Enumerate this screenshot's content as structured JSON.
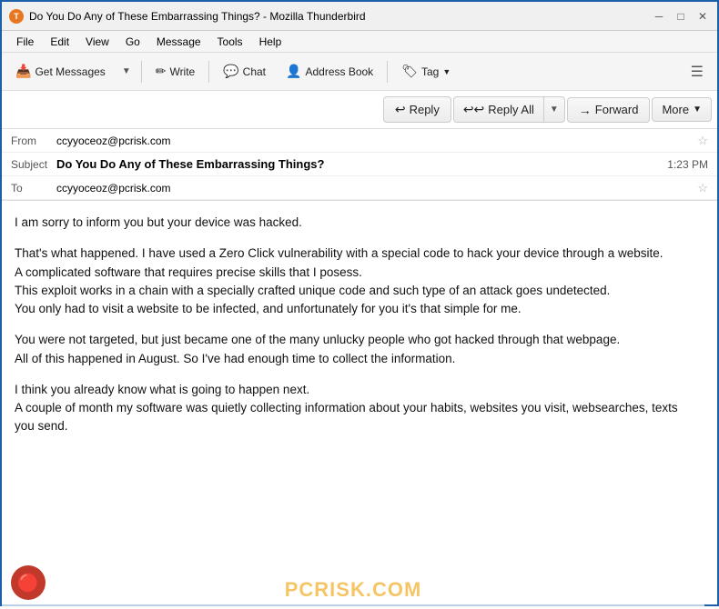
{
  "titlebar": {
    "icon": "🦅",
    "title": "Do You Do Any of These Embarrassing Things? - Mozilla Thunderbird",
    "minimize": "─",
    "restore": "□",
    "close": "✕"
  },
  "menubar": {
    "items": [
      "File",
      "Edit",
      "View",
      "Go",
      "Message",
      "Tools",
      "Help"
    ]
  },
  "toolbar": {
    "get_messages": "Get Messages",
    "get_messages_icon": "📥",
    "write": "Write",
    "write_icon": "✏",
    "chat": "Chat",
    "chat_icon": "💬",
    "address_book": "Address Book",
    "address_book_icon": "👤",
    "tag": "Tag",
    "tag_icon": "🏷",
    "hamburger": "☰"
  },
  "actions": {
    "reply": "Reply",
    "reply_icon": "↩",
    "reply_all": "Reply All",
    "reply_all_icon": "↩↩",
    "forward": "Forward",
    "forward_icon": "→",
    "more": "More",
    "more_arrow": "▼"
  },
  "email": {
    "from_label": "From",
    "from_value": "ccyyoceoz@pcrisk.com",
    "subject_label": "Subject",
    "subject_value": "Do You Do Any of These Embarrassing Things?",
    "time": "1:23 PM",
    "to_label": "To",
    "to_value": "ccyyoceoz@pcrisk.com",
    "body_paragraphs": [
      "I am sorry to inform you but your device was hacked.",
      "That's what happened. I have used a Zero Click vulnerability with a special code to hack your device through a website.\nA complicated software that requires precise skills that I posess.\nThis exploit works in a chain with a specially crafted unique code and such type of an attack goes undetected.\nYou only had to visit a website to be infected, and unfortunately for you it's that simple for me.",
      "You were not targeted, but just became one of the many unlucky people who got hacked through that webpage.\nAll of this happened in August. So I've had enough time to collect the information.",
      "I think you already know what is going to happen next.\nA couple of month my software was quietly collecting information about your habits, websites you visit, websearches, texts you send."
    ]
  },
  "watermark": {
    "text": "PCRISK.COM"
  }
}
